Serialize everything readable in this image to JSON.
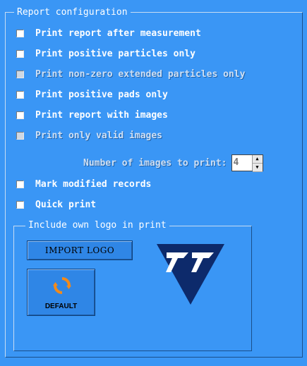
{
  "panel": {
    "title": "Report configuration"
  },
  "options": [
    {
      "label": "Print report after measurement",
      "checked": false,
      "enabled": true
    },
    {
      "label": "Print positive particles only",
      "checked": false,
      "enabled": true
    },
    {
      "label": "Print non-zero extended particles only",
      "checked": false,
      "enabled": false
    },
    {
      "label": "Print positive pads only",
      "checked": false,
      "enabled": true
    },
    {
      "label": "Print report with images",
      "checked": false,
      "enabled": true
    },
    {
      "label": "Print only valid images",
      "checked": false,
      "enabled": false
    }
  ],
  "images_to_print": {
    "label": "Number of images to print:",
    "value": "4",
    "enabled": false
  },
  "more_options": [
    {
      "label": "Mark modified records",
      "checked": false,
      "enabled": true
    },
    {
      "label": "Quick print",
      "checked": false,
      "enabled": true
    }
  ],
  "logo_group": {
    "title": "Include own logo in print",
    "import_label": "IMPORT LOGO",
    "default_label": "DEFAULT"
  },
  "colors": {
    "background": "#3a96f5",
    "logo_navy": "#0d2a6b",
    "refresh_orange": "#f28a1a"
  },
  "icons": {
    "refresh": "refresh-icon",
    "logo": "company-logo"
  }
}
